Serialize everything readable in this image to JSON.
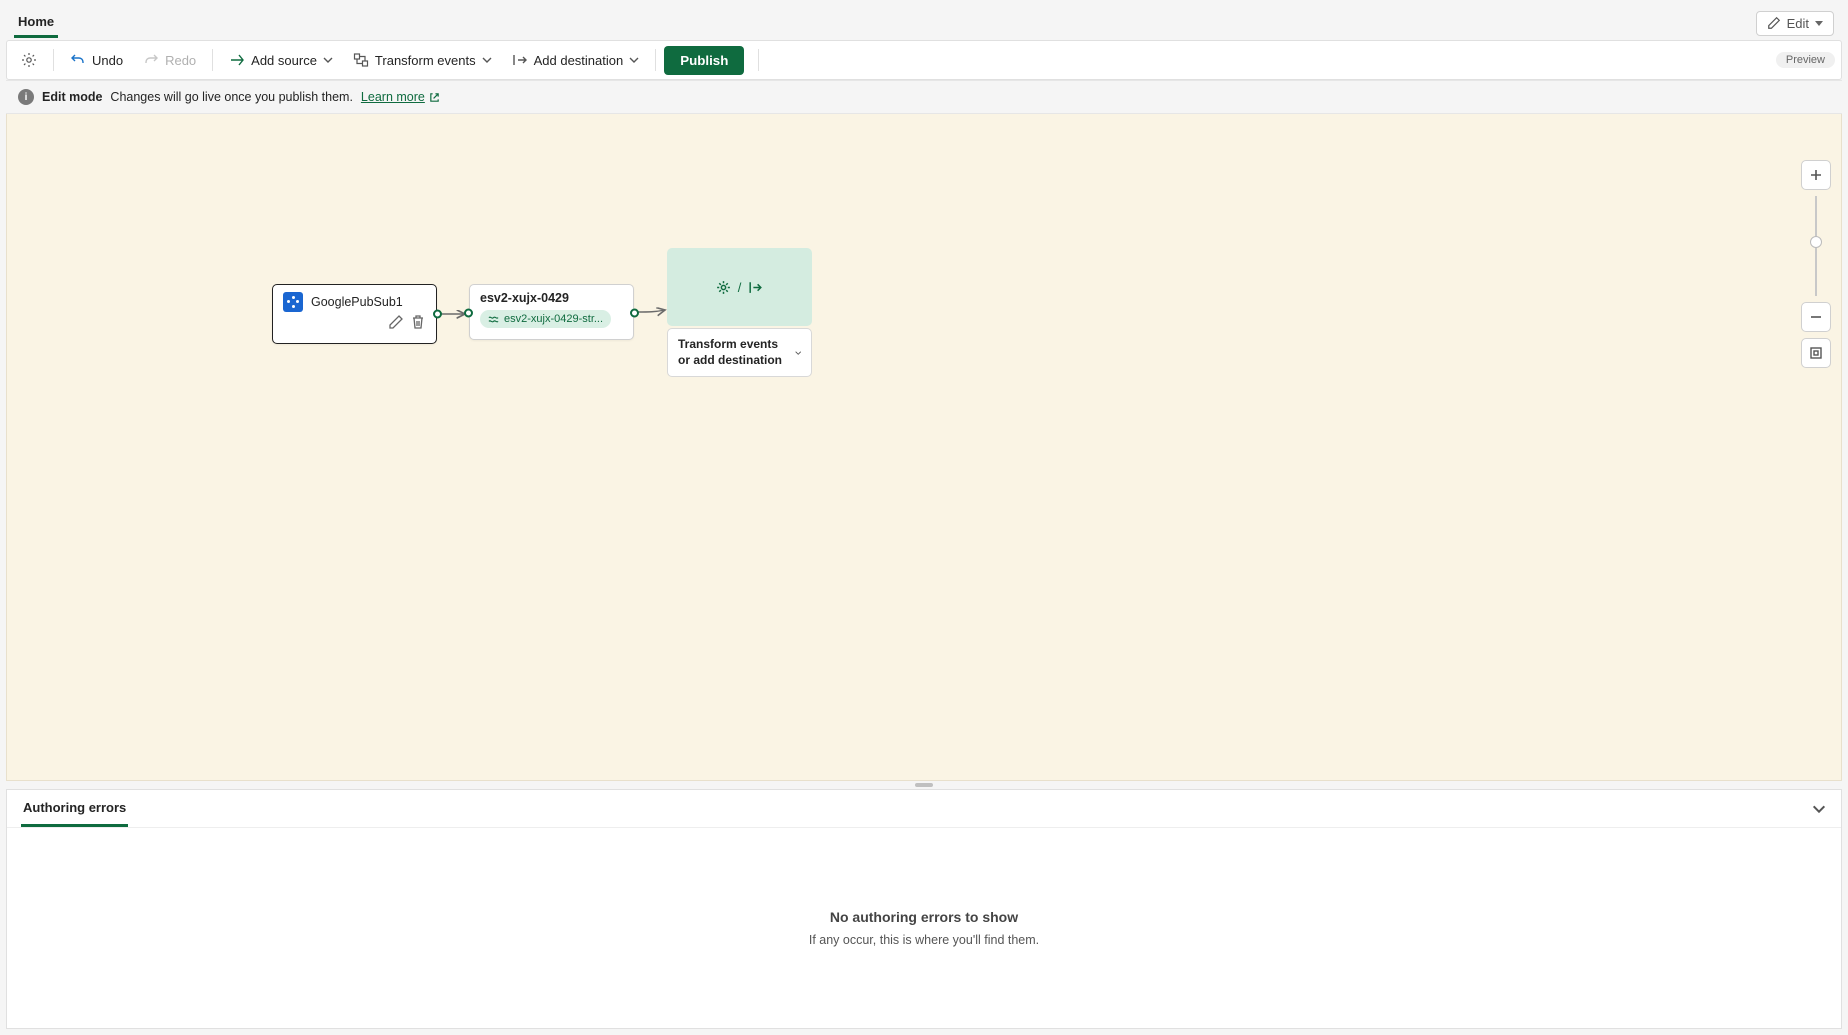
{
  "tabs": {
    "home": "Home"
  },
  "editMenu": {
    "label": "Edit"
  },
  "toolbar": {
    "undo": "Undo",
    "redo": "Redo",
    "addSource": "Add source",
    "transform": "Transform events",
    "addDestination": "Add destination",
    "publish": "Publish",
    "preview": "Preview"
  },
  "infoBar": {
    "mode": "Edit mode",
    "message": "Changes will go live once you publish them.",
    "learnMore": "Learn more"
  },
  "nodes": {
    "source": {
      "title": "GooglePubSub1"
    },
    "stream": {
      "title": "esv2-xujx-0429",
      "chip": "esv2-xujx-0429-str..."
    },
    "destPlaceholder": {
      "label": "Transform events or add destination",
      "separator": "/"
    }
  },
  "bottomPanel": {
    "tab": "Authoring errors",
    "emptyTitle": "No authoring errors to show",
    "emptySubtitle": "If any occur, this is where you'll find them."
  }
}
